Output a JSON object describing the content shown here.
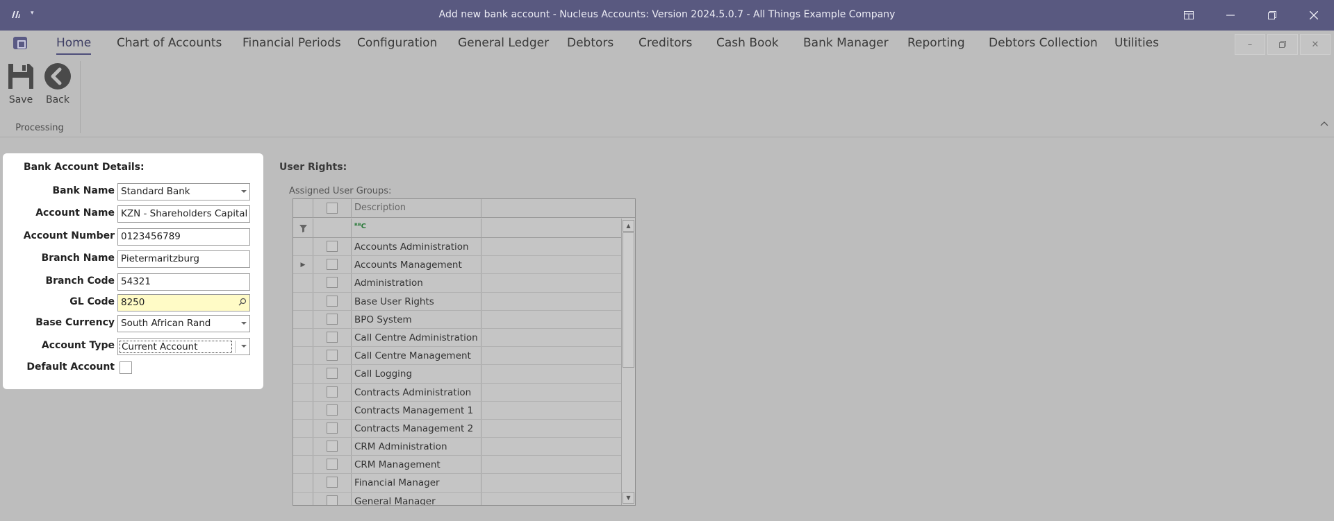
{
  "window": {
    "title": "Add new bank account - Nucleus Accounts: Version 2024.5.0.7 - All Things Example Company",
    "sysmenu_glyph": "▾"
  },
  "ribbon": {
    "tabs": [
      "Home",
      "Chart of Accounts",
      "Financial Periods",
      "Configuration",
      "General Ledger",
      "Debtors",
      "Creditors",
      "Cash Book",
      "Bank Manager",
      "Reporting",
      "Debtors Collection",
      "Utilities"
    ],
    "active_tab": "Home",
    "save_label": "Save",
    "back_label": "Back",
    "group_label": "Processing"
  },
  "details": {
    "heading": "Bank Account Details:",
    "bank_name_label": "Bank Name",
    "bank_name": "Standard Bank",
    "account_name_label": "Account Name",
    "account_name": "KZN - Shareholders Capital",
    "account_number_label": "Account Number",
    "account_number": "0123456789",
    "branch_name_label": "Branch Name",
    "branch_name": "Pietermaritzburg",
    "branch_code_label": "Branch Code",
    "branch_code": "54321",
    "gl_code_label": "GL Code",
    "gl_code": "8250",
    "base_currency_label": "Base Currency",
    "base_currency": "South African Rand",
    "account_type_label": "Account Type",
    "account_type": "Current Account",
    "default_account_label": "Default Account"
  },
  "user_rights": {
    "heading": "User Rights:",
    "subheading": "Assigned User Groups:",
    "description_header": "Description",
    "filter_glyph": "ᴿᴮC",
    "groups": [
      "Accounts Administration",
      "Accounts Management",
      "Administration",
      "Base User Rights",
      "BPO System",
      "Call Centre Administration",
      "Call Centre Management",
      "Call Logging",
      "Contracts Administration",
      "Contracts Management 1",
      "Contracts Management 2",
      "CRM Administration",
      "CRM Management",
      "Financial Manager",
      "General Manager"
    ],
    "current_row_index": 1
  },
  "colors": {
    "titlebar": "#595980",
    "gl_code_highlight": "#fffbc6",
    "ribbon_background": "#bdbdbd"
  }
}
